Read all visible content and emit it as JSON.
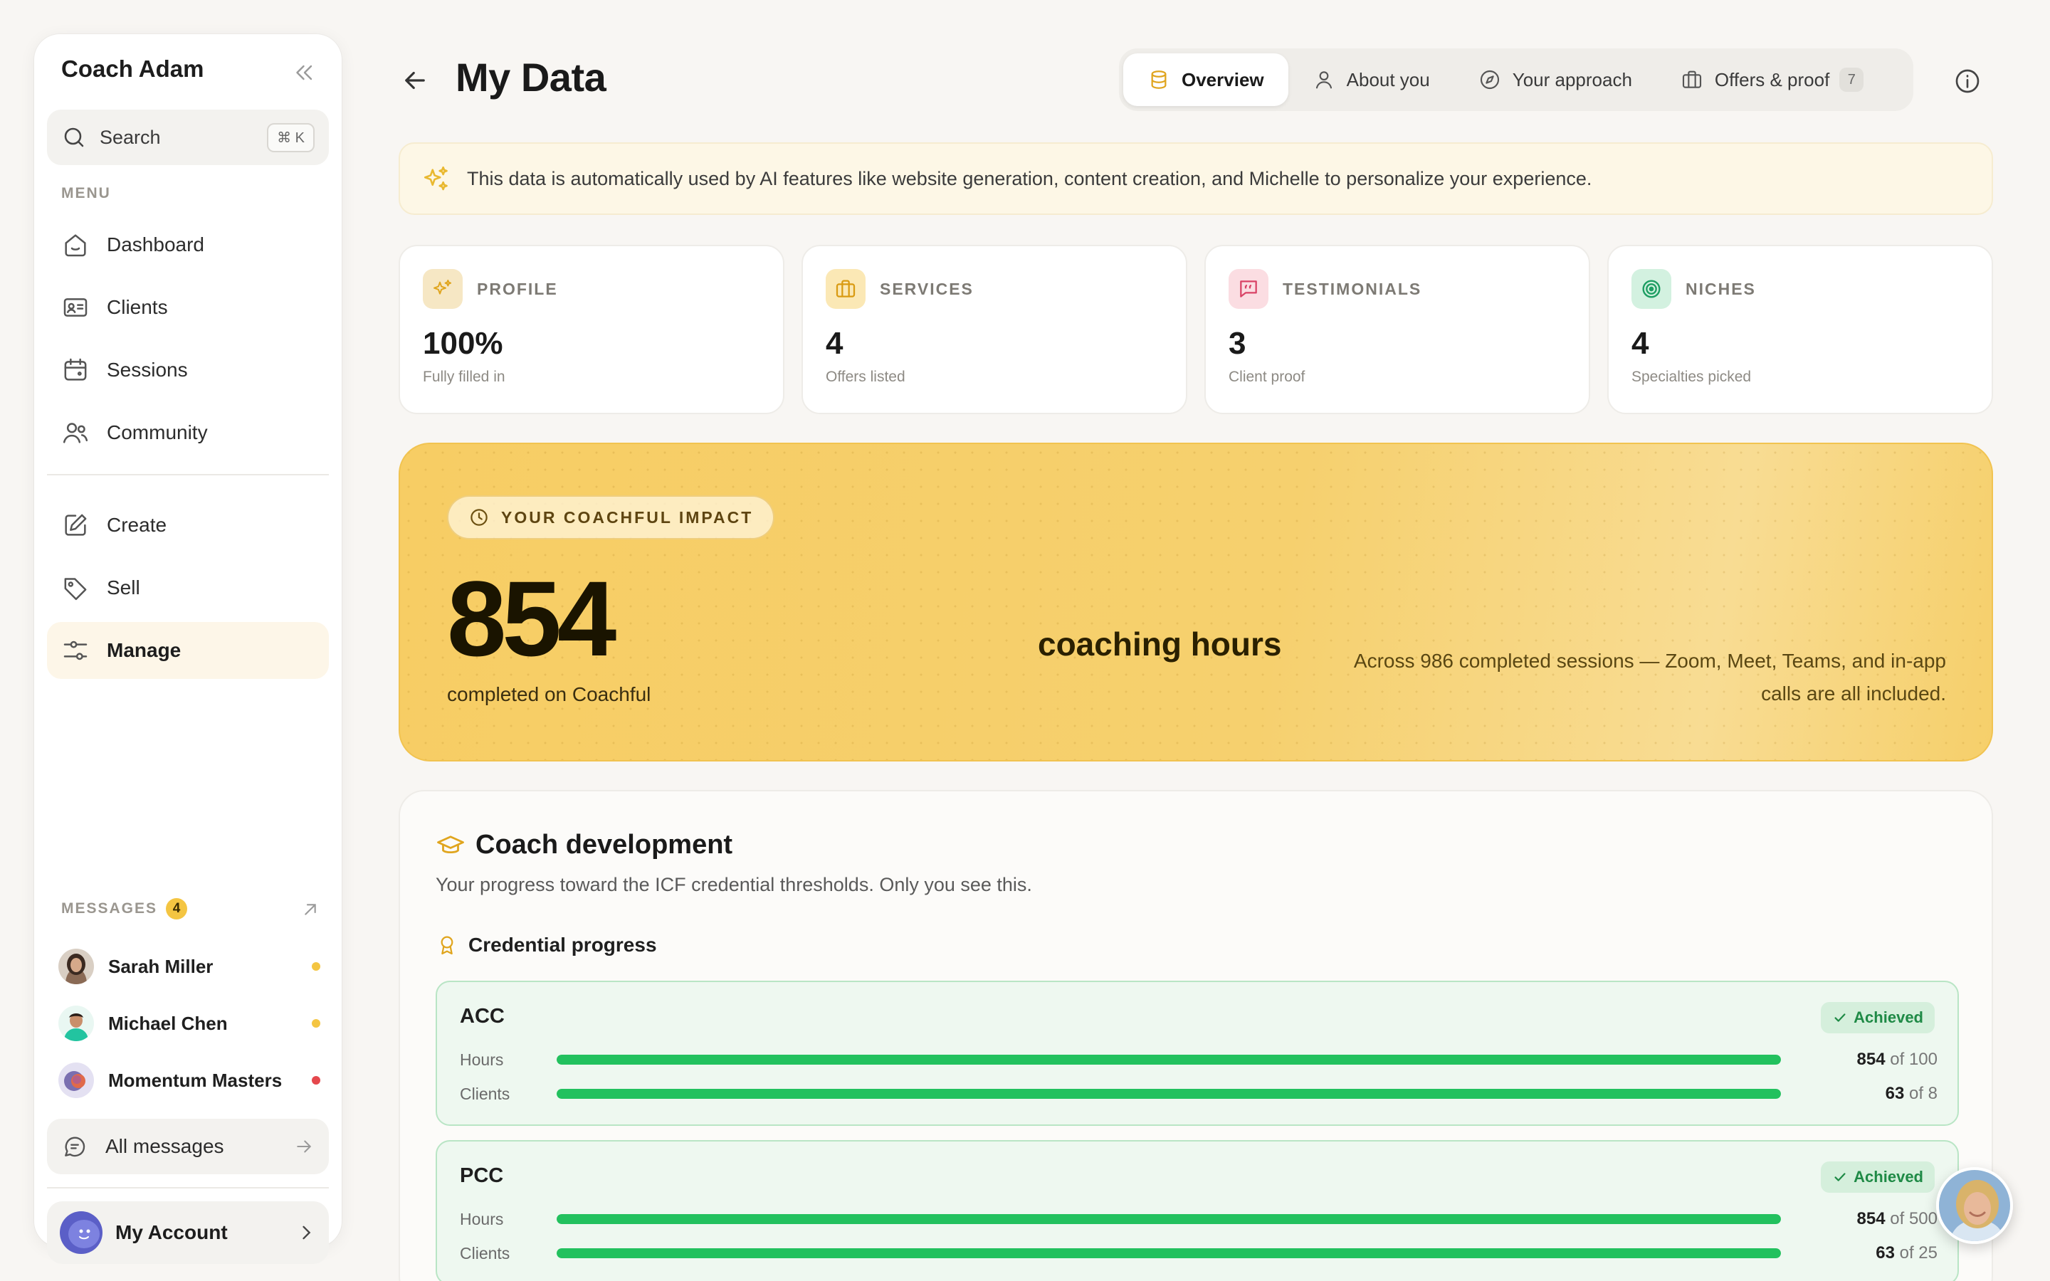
{
  "sidebar": {
    "title": "Coach Adam",
    "search": {
      "label": "Search",
      "shortcut": "⌘ K"
    },
    "menu_label": "MENU",
    "items": [
      {
        "label": "Dashboard",
        "icon": "dashboard-icon"
      },
      {
        "label": "Clients",
        "icon": "id-card-icon"
      },
      {
        "label": "Sessions",
        "icon": "calendar-icon"
      },
      {
        "label": "Community",
        "icon": "users-icon"
      },
      {
        "label": "Create",
        "icon": "edit-icon"
      },
      {
        "label": "Sell",
        "icon": "tag-icon"
      },
      {
        "label": "Manage",
        "icon": "sliders-icon",
        "active": true
      }
    ],
    "messages": {
      "label": "MESSAGES",
      "count": "4",
      "threads": [
        {
          "name": "Sarah Miller",
          "dot_color": "#f4c542"
        },
        {
          "name": "Michael Chen",
          "dot_color": "#f4c542"
        },
        {
          "name": "Momentum Masters",
          "dot_color": "#e5484d"
        }
      ],
      "all_label": "All messages"
    },
    "account_label": "My Account"
  },
  "header": {
    "title": "My Data",
    "tabs": [
      {
        "label": "Overview",
        "icon": "database-icon",
        "active": true
      },
      {
        "label": "About you",
        "icon": "user-icon"
      },
      {
        "label": "Your approach",
        "icon": "compass-icon"
      },
      {
        "label": "Offers & proof",
        "icon": "briefcase-icon",
        "count": "7"
      }
    ]
  },
  "notice": "This data is automatically used by AI features like website generation, content creation, and Michelle to personalize your experience.",
  "stats": [
    {
      "caption": "PROFILE",
      "value": "100%",
      "sub": "Fully filled in",
      "icon": "sparkles-icon",
      "color": "#f6e7c4"
    },
    {
      "caption": "SERVICES",
      "value": "4",
      "sub": "Offers listed",
      "icon": "briefcase-icon",
      "color": "#fbe8b5"
    },
    {
      "caption": "TESTIMONIALS",
      "value": "3",
      "sub": "Client proof",
      "icon": "quote-icon",
      "color": "#fbdde2"
    },
    {
      "caption": "NICHES",
      "value": "4",
      "sub": "Specialties picked",
      "icon": "target-icon",
      "color": "#d3f1e0"
    }
  ],
  "impact": {
    "pill": "YOUR COACHFUL IMPACT",
    "number": "854",
    "unit": "coaching hours",
    "sub": "completed on Coachful",
    "note": "Across 986 completed sessions — Zoom, Meet, Teams, and in-app calls are all included."
  },
  "development": {
    "title": "Coach development",
    "subtitle": "Your progress toward the ICF credential thresholds. Only you see this.",
    "progress_title": "Credential progress",
    "credentials": [
      {
        "name": "ACC",
        "status": "Achieved",
        "metrics": [
          {
            "label": "Hours",
            "value": "854",
            "of": "of 100",
            "fraction": 1.0
          },
          {
            "label": "Clients",
            "value": "63",
            "of": "of 8",
            "fraction": 1.0
          }
        ]
      },
      {
        "name": "PCC",
        "status": "Achieved",
        "metrics": [
          {
            "label": "Hours",
            "value": "854",
            "of": "of 500",
            "fraction": 1.0
          },
          {
            "label": "Clients",
            "value": "63",
            "of": "of 25",
            "fraction": 1.0
          }
        ]
      }
    ]
  },
  "colors": {
    "accent": "#f4c542",
    "success": "#22c15e",
    "danger": "#e5484d"
  }
}
